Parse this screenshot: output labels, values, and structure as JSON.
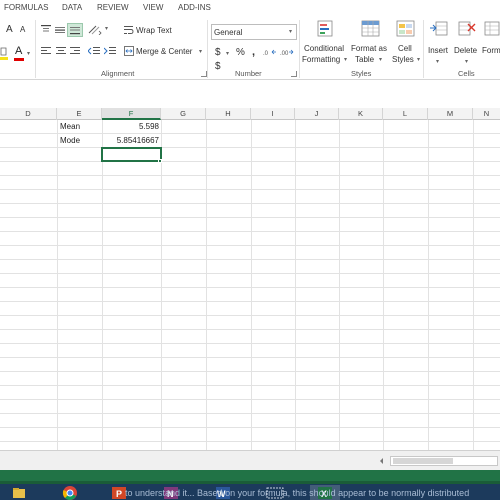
{
  "menu": {
    "tabs": [
      "FORMULAS",
      "DATA",
      "REVIEW",
      "VIEW",
      "ADD-INS"
    ]
  },
  "ribbon": {
    "font_grow": "A",
    "font_shrink": "A",
    "wrap_text": "Wrap Text",
    "merge_center": "Merge & Center",
    "number_format": "General",
    "currency_symbol": "$",
    "percent_symbol": "%",
    "comma_symbol": ",",
    "conditional_formatting": [
      "Conditional",
      "Formatting"
    ],
    "format_as_table": [
      "Format as",
      "Table"
    ],
    "cell_styles": [
      "Cell",
      "Styles"
    ],
    "insert": "Insert",
    "delete": "Delete",
    "format": "Format",
    "groups": {
      "alignment": "Alignment",
      "number": "Number",
      "styles": "Styles",
      "cells": "Cells"
    }
  },
  "columns": [
    "D",
    "E",
    "F",
    "G",
    "H",
    "I",
    "J",
    "K",
    "L",
    "M",
    "N"
  ],
  "selected_column": "F",
  "cells": {
    "e1": "Mean",
    "f1": "5.598",
    "e2": "Mode",
    "f2": "5.85416667"
  },
  "caption": "to understand it... Based on your formula, this should appear to be normally distributed",
  "colors": {
    "excel_green": "#217346",
    "taskbar": "#1c3a5c",
    "header_bg": "#f3f3f3",
    "gridline": "#e2e2e2"
  }
}
